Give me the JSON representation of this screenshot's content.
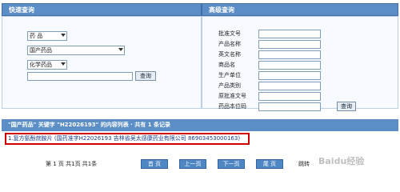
{
  "quick": {
    "title": "快速查询",
    "select1": "药  品",
    "select2": "国产药品",
    "select3": "化学药品",
    "search_btn": "查询"
  },
  "advanced": {
    "title": "高级查询",
    "fields": [
      "批准文号",
      "产品名称",
      "英文名称",
      "商品名",
      "生产单位",
      "产品类别",
      "原批准文号",
      "药品本位码"
    ],
    "search_btn": "查询"
  },
  "results": {
    "header": "\"国产药品\" 关键字 \"H22026193\" 的内容列表 · 共有 1 条记录",
    "rows": [
      "1.复方氨酚烷胺片 (国药准字H22026193 吉林省吴太感康药业有限公司 86903453000163)"
    ]
  },
  "pager": {
    "info": "第 1 页  共1页  共1条",
    "buttons": [
      "首 页",
      "上一页",
      "下一页",
      "尾 页"
    ],
    "jump_label": "跳转"
  },
  "watermark": "Baidu经验"
}
